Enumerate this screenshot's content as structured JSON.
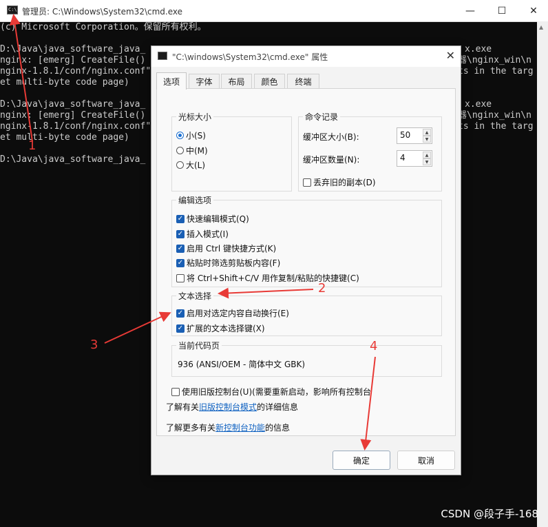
{
  "window": {
    "title": "管理员: C:\\Windows\\System32\\cmd.exe",
    "controls": {
      "minimize": "—",
      "maximize": "☐",
      "close": "✕"
    }
  },
  "console": {
    "lines": [
      "(c) Microsoft Corporation。保留所有权利。",
      "",
      "D:\\Java\\java_software_java_",
      "nginx: [emerg] CreateFile()",
      "nginx-1.8.1/conf/nginx.conf\"",
      "et multi-byte code page)",
      "",
      "D:\\Java\\java_software_java_",
      "nginx: [emerg] CreateFile()",
      "nginx-1.8.1/conf/nginx.conf\"",
      "et multi-byte code page)",
      "",
      "D:\\Java\\java_software_java_"
    ],
    "right_fragments": [
      {
        "row": 2,
        "text": "x.exe"
      },
      {
        "row": 3,
        "text": "器\\nginx_win\\n"
      },
      {
        "row": 4,
        "text": "ts in the targ"
      },
      {
        "row": 7,
        "text": "x.exe"
      },
      {
        "row": 8,
        "text": "器\\nginx_win\\n"
      },
      {
        "row": 9,
        "text": "ts in the targ"
      }
    ]
  },
  "dialog": {
    "title": "\"C:\\windows\\System32\\cmd.exe\" 属性",
    "close": "✕",
    "tabs": [
      {
        "label": "选项",
        "active": true
      },
      {
        "label": "字体",
        "active": false
      },
      {
        "label": "布局",
        "active": false
      },
      {
        "label": "颜色",
        "active": false
      },
      {
        "label": "终端",
        "active": false
      }
    ],
    "cursor_size": {
      "label": "光标大小",
      "options": [
        {
          "label": "小(S)",
          "checked": true
        },
        {
          "label": "中(M)",
          "checked": false
        },
        {
          "label": "大(L)",
          "checked": false
        }
      ]
    },
    "command_history": {
      "label": "命令记录",
      "buffer_size_label": "缓冲区大小(B):",
      "buffer_size": "50",
      "buffer_count_label": "缓冲区数量(N):",
      "buffer_count": "4",
      "discard_label": "丢弃旧的副本(D)",
      "discard_checked": false
    },
    "edit_options": {
      "label": "编辑选项",
      "items": [
        {
          "label": "快速编辑模式(Q)",
          "checked": true
        },
        {
          "label": "插入模式(I)",
          "checked": true
        },
        {
          "label": "启用 Ctrl 键快捷方式(K)",
          "checked": true
        },
        {
          "label": "粘贴时筛选剪贴板内容(F)",
          "checked": true
        },
        {
          "label": "将 Ctrl+Shift+C/V 用作复制/粘贴的快捷键(C)",
          "checked": false
        }
      ]
    },
    "text_selection": {
      "label": "文本选择",
      "items": [
        {
          "label": "启用对选定内容自动换行(E)",
          "checked": true
        },
        {
          "label": "扩展的文本选择键(X)",
          "checked": true
        }
      ]
    },
    "codepage": {
      "label": "当前代码页",
      "value": "936   (ANSI/OEM - 简体中文 GBK)"
    },
    "legacy": {
      "label": "使用旧版控制台(U)(需要重新启动，影响所有控制台",
      "checked": false
    },
    "info1": {
      "prefix": "了解有关",
      "link": "旧版控制台模式",
      "suffix": "的详细信息"
    },
    "info2": {
      "prefix": "了解更多有关",
      "link": "新控制台功能",
      "suffix": "的信息"
    },
    "ok_label": "确定",
    "cancel_label": "取消"
  },
  "annotations": {
    "color": "#e83a36",
    "labels": [
      "1",
      "2",
      "3",
      "4"
    ]
  },
  "watermark": "CSDN @段子手-168"
}
